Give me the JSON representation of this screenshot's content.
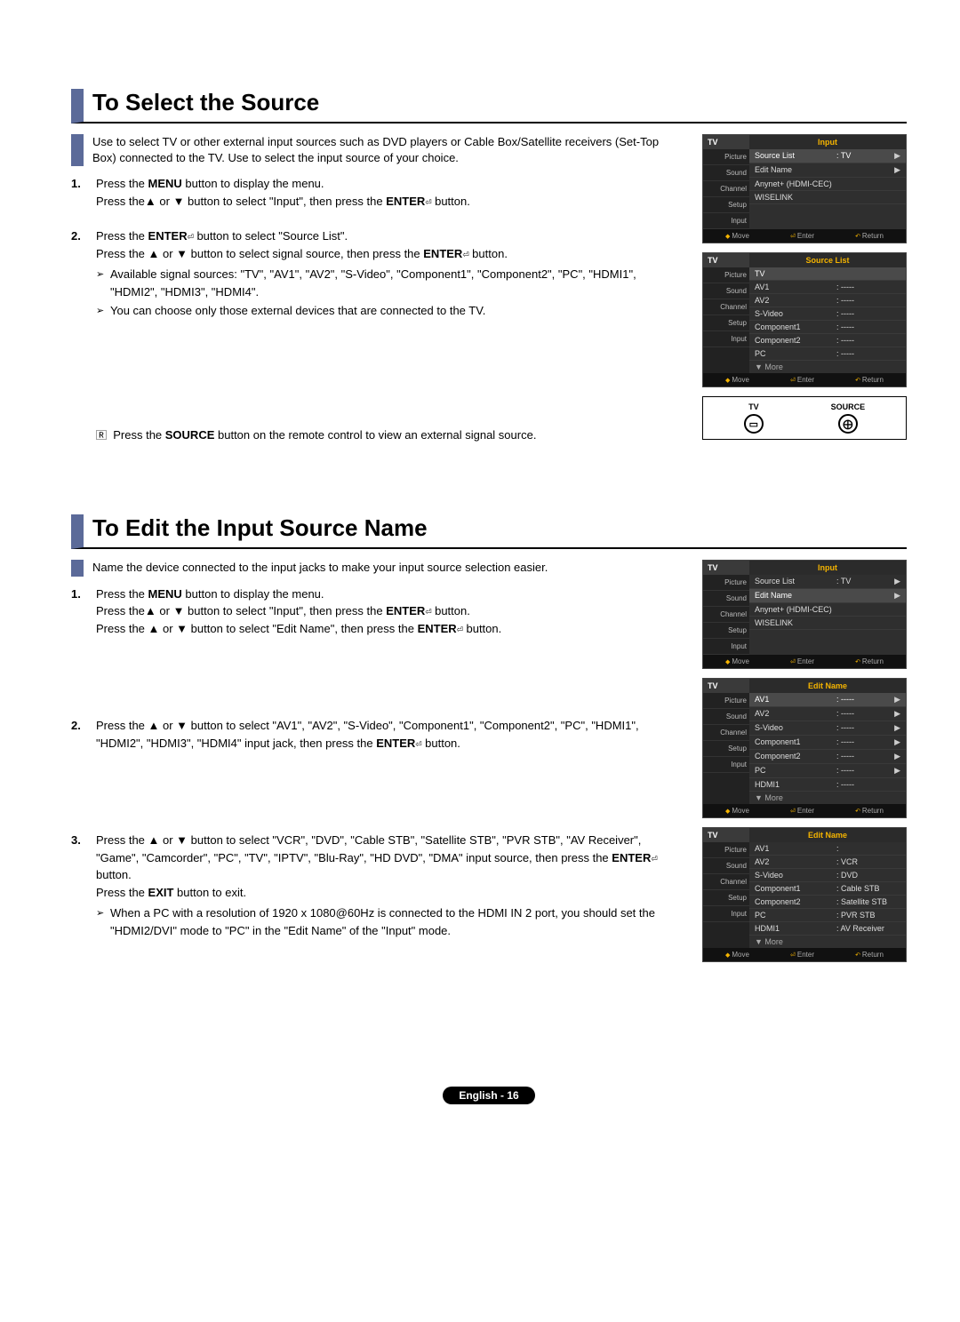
{
  "section1": {
    "title": "To Select the Source",
    "intro": "Use to select TV or other external input sources such as DVD players or Cable Box/Satellite receivers (Set-Top Box) connected to the TV. Use to select the input source of your choice.",
    "steps": [
      {
        "a": "Press the ",
        "b": "MENU",
        "c": " button to display the menu.",
        "d": "Press the▲ or ▼ button to select \"Input\", then press the ",
        "e": "ENTER",
        "f": " button."
      },
      {
        "a": "Press the ",
        "b": "ENTER",
        "c": " button to select \"Source List\".",
        "d": "Press the ▲ or ▼ button to select signal source, then press the ",
        "e": "ENTER",
        "f": " button.",
        "sub1": "Available signal sources: \"TV\", \"AV1\", \"AV2\", \"S-Video\", \"Component1\", \"Component2\", \"PC\", \"HDMI1\", \"HDMI2\", \"HDMI3\", \"HDMI4\".",
        "sub2": "You can choose only those external devices that are connected to the TV."
      }
    ],
    "note_a": "Press the ",
    "note_b": "SOURCE",
    "note_c": " button on the remote control to view an external signal source."
  },
  "section2": {
    "title": "To Edit the Input Source Name",
    "intro": "Name the device connected to the input jacks to make your input source selection easier.",
    "steps": [
      {
        "a": "Press the ",
        "b": "MENU",
        "c": " button to display the menu.",
        "d": "Press the▲ or ▼ button to select \"Input\", then press the ",
        "e": "ENTER",
        "f": " button.",
        "g": "Press the ▲ or ▼ button to select \"Edit Name\", then press the ",
        "h": "ENTER",
        "i": " button."
      },
      {
        "a": "Press the ▲ or ▼ button to select \"AV1\", \"AV2\", \"S-Video\", \"Component1\", \"Component2\", \"PC\", \"HDMI1\", \"HDMI2\", \"HDMI3\", \"HDMI4\" input jack, then press the ",
        "b": "ENTER",
        "c": " button."
      },
      {
        "a": "Press the ▲ or ▼ button to select \"VCR\", \"DVD\", \"Cable STB\", \"Satellite STB\", \"PVR STB\", \"AV Receiver\", \"Game\", \"Camcorder\", \"PC\", \"TV\", \"IPTV\", \"Blu-Ray\", \"HD DVD\", \"DMA\" input source, then press the ",
        "b": "ENTER",
        "c": " button.",
        "d": "Press the ",
        "e": "EXIT",
        "f": " button to exit.",
        "sub1": "When a PC with a resolution of 1920 x 1080@60Hz is connected to the HDMI IN 2 port, you should set the \"HDMI2/DVI\" mode to \"PC\" in the \"Edit Name\" of the \"Input\" mode."
      }
    ]
  },
  "osd": {
    "tv": "TV",
    "icons": [
      "Picture",
      "Sound",
      "Channel",
      "Setup",
      "Input"
    ],
    "foot": {
      "move": "Move",
      "enter": "Enter",
      "return": "Return"
    },
    "panel_input": {
      "title": "Input",
      "rows": [
        {
          "lbl": "Source List",
          "val": ": TV",
          "arr": "▶",
          "hl": true
        },
        {
          "lbl": "Edit Name",
          "val": "",
          "arr": "▶"
        },
        {
          "lbl": "Anynet+ (HDMI-CEC)",
          "val": "",
          "arr": ""
        },
        {
          "lbl": "WISELINK",
          "val": "",
          "arr": ""
        }
      ]
    },
    "panel_source": {
      "title": "Source List",
      "rows": [
        {
          "lbl": "TV",
          "val": "",
          "hl": true
        },
        {
          "lbl": "AV1",
          "val": ": -----"
        },
        {
          "lbl": "AV2",
          "val": ": -----"
        },
        {
          "lbl": "S-Video",
          "val": ": -----"
        },
        {
          "lbl": "Component1",
          "val": ": -----"
        },
        {
          "lbl": "Component2",
          "val": ": -----"
        },
        {
          "lbl": "PC",
          "val": ": -----"
        }
      ],
      "more": "▼ More"
    },
    "panel_input2": {
      "title": "Input",
      "rows": [
        {
          "lbl": "Source List",
          "val": ": TV",
          "arr": "▶"
        },
        {
          "lbl": "Edit Name",
          "val": "",
          "arr": "▶",
          "hl": true
        },
        {
          "lbl": "Anynet+ (HDMI-CEC)",
          "val": "",
          "arr": ""
        },
        {
          "lbl": "WISELINK",
          "val": "",
          "arr": ""
        }
      ]
    },
    "panel_editname": {
      "title": "Edit Name",
      "rows": [
        {
          "lbl": "AV1",
          "val": ": -----",
          "arr": "▶",
          "hl": true
        },
        {
          "lbl": "AV2",
          "val": ": -----",
          "arr": "▶"
        },
        {
          "lbl": "S-Video",
          "val": ": -----",
          "arr": "▶"
        },
        {
          "lbl": "Component1",
          "val": ": -----",
          "arr": "▶"
        },
        {
          "lbl": "Component2",
          "val": ": -----",
          "arr": "▶"
        },
        {
          "lbl": "PC",
          "val": ": -----",
          "arr": "▶"
        },
        {
          "lbl": "HDMI1",
          "val": ": -----",
          "arr": ""
        }
      ],
      "more": "▼ More"
    },
    "panel_editname2": {
      "title": "Edit Name",
      "rows": [
        {
          "lbl": "AV1",
          "val": ":",
          "arr": ""
        },
        {
          "lbl": "AV2",
          "val": ":",
          "opt": "VCR"
        },
        {
          "lbl": "S-Video",
          "val": ":",
          "opt": "DVD"
        },
        {
          "lbl": "Component1",
          "val": ":",
          "opt": "Cable STB"
        },
        {
          "lbl": "Component2",
          "val": ":",
          "opt": "Satellite STB"
        },
        {
          "lbl": "PC",
          "val": ":",
          "opt": "PVR STB"
        },
        {
          "lbl": "HDMI1",
          "val": ":",
          "opt": "AV Receiver"
        }
      ],
      "more": "▼ More"
    }
  },
  "remote": {
    "tv": "TV",
    "source": "SOURCE",
    "sym": "⨁"
  },
  "footer": "English - 16"
}
